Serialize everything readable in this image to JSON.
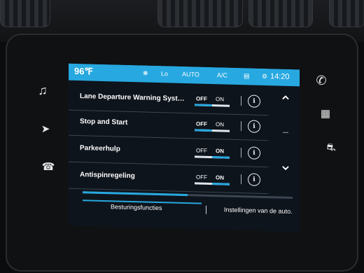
{
  "status_bar": {
    "temperature": "96℉",
    "fan_icon": "fan-icon",
    "fan_level": "Lo",
    "mode": "AUTO",
    "ac": "A/C",
    "time": "14:20"
  },
  "side_left": [
    "music-note-icon",
    "navigation-icon",
    "phone-book-icon"
  ],
  "side_right": [
    "phone-icon",
    "apps-grid-icon",
    "car-icon"
  ],
  "settings": [
    {
      "label": "Lane Departure Warning Syst…",
      "off": "OFF",
      "on": "ON",
      "state": "off"
    },
    {
      "label": "Stop and Start",
      "off": "OFF",
      "on": "ON",
      "state": "off"
    },
    {
      "label": "Parkeerhulp",
      "off": "OFF",
      "on": "ON",
      "state": "on"
    },
    {
      "label": "Antispinregeling",
      "off": "OFF",
      "on": "ON",
      "state": "on"
    }
  ],
  "tabs": [
    {
      "label": "Besturingsfuncties",
      "active": true
    },
    {
      "label": "Instellingen van de auto."
    }
  ],
  "colors": {
    "accent": "#27a8e0",
    "screen_bg": "#0e141c"
  }
}
